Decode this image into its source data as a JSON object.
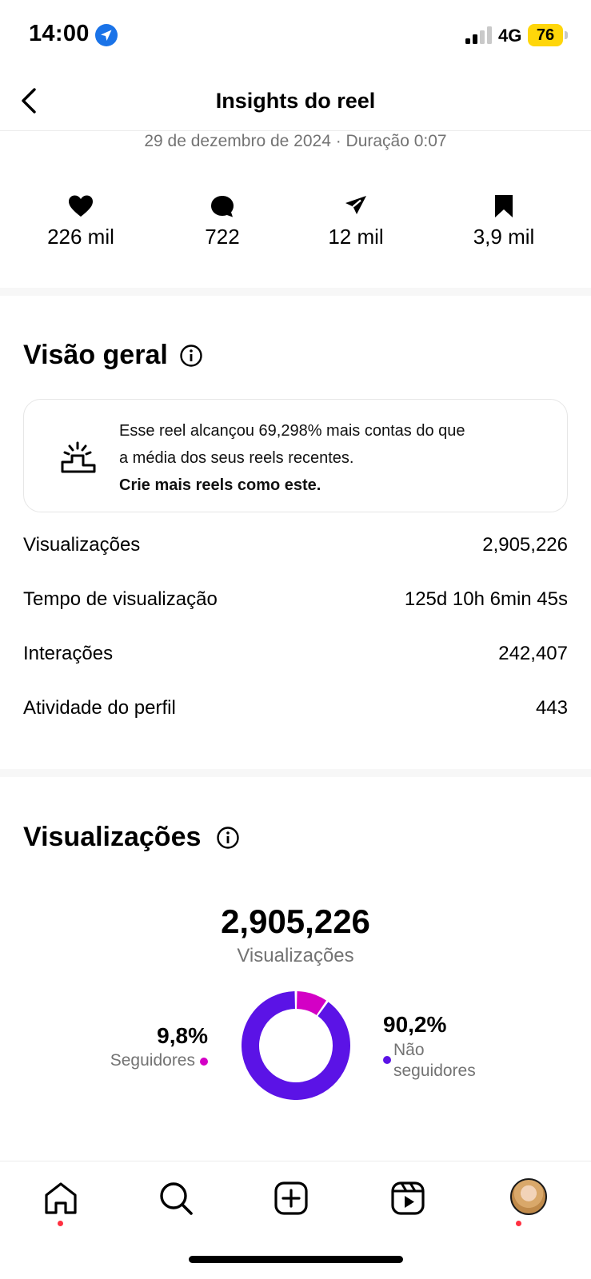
{
  "status_bar": {
    "time": "14:00",
    "network": "4G",
    "battery": "76"
  },
  "header": {
    "title": "Insights do reel"
  },
  "subtitle": "29 de dezembro de 2024 · Duração 0:07",
  "stats": [
    {
      "icon": "heart-icon",
      "value": "226 mil"
    },
    {
      "icon": "comment-icon",
      "value": "722"
    },
    {
      "icon": "share-icon",
      "value": "12 mil"
    },
    {
      "icon": "bookmark-icon",
      "value": "3,9 mil"
    }
  ],
  "overview": {
    "title": "Visão geral",
    "card_line1": "Esse reel alcançou 69,298% mais contas do que",
    "card_line2": "a média dos seus reels recentes.",
    "card_cta": "Crie mais reels como este.",
    "metrics": [
      {
        "label": "Visualizações",
        "value": "2,905,226"
      },
      {
        "label": "Tempo de visualização",
        "value": "125d 10h 6min 45s"
      },
      {
        "label": "Interações",
        "value": "242,407"
      },
      {
        "label": "Atividade do perfil",
        "value": "443"
      }
    ]
  },
  "views": {
    "title": "Visualizações",
    "total": "2,905,226",
    "caption": "Visualizações",
    "followers_pct": "9,8%",
    "followers_label": "Seguidores",
    "non_followers_pct": "90,2%",
    "non_followers_label": "Não seguidores"
  },
  "chart_data": {
    "type": "pie",
    "categories": [
      "Seguidores",
      "Não seguidores"
    ],
    "values": [
      9.8,
      90.2
    ],
    "colors": [
      "#d300c5",
      "#5b13e6"
    ]
  },
  "nav": {
    "items": [
      "home-icon",
      "search-icon",
      "create-icon",
      "reels-icon",
      "profile-avatar"
    ]
  }
}
